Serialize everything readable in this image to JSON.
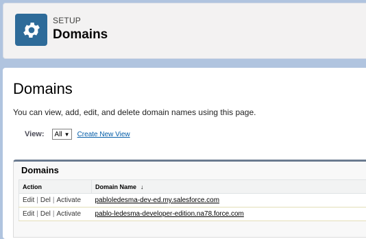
{
  "header": {
    "eyebrow": "SETUP",
    "title": "Domains",
    "icon": "gear-icon",
    "icon_color": "#2e6b99"
  },
  "page": {
    "title": "Domains",
    "description": "You can view, add, edit, and delete domain names using this page."
  },
  "view": {
    "label": "View:",
    "selected": "All",
    "create_link": "Create New View"
  },
  "list": {
    "title": "Domains",
    "columns": [
      "Action",
      "Domain Name"
    ],
    "sort_indicator": "↓",
    "actions": {
      "edit": "Edit",
      "del": "Del",
      "activate": "Activate",
      "separator": "|"
    },
    "rows": [
      {
        "domain": "pabloledesma-dev-ed.my.salesforce.com"
      },
      {
        "domain": "pablo-ledesma-developer-edition.na78.force.com"
      }
    ]
  }
}
